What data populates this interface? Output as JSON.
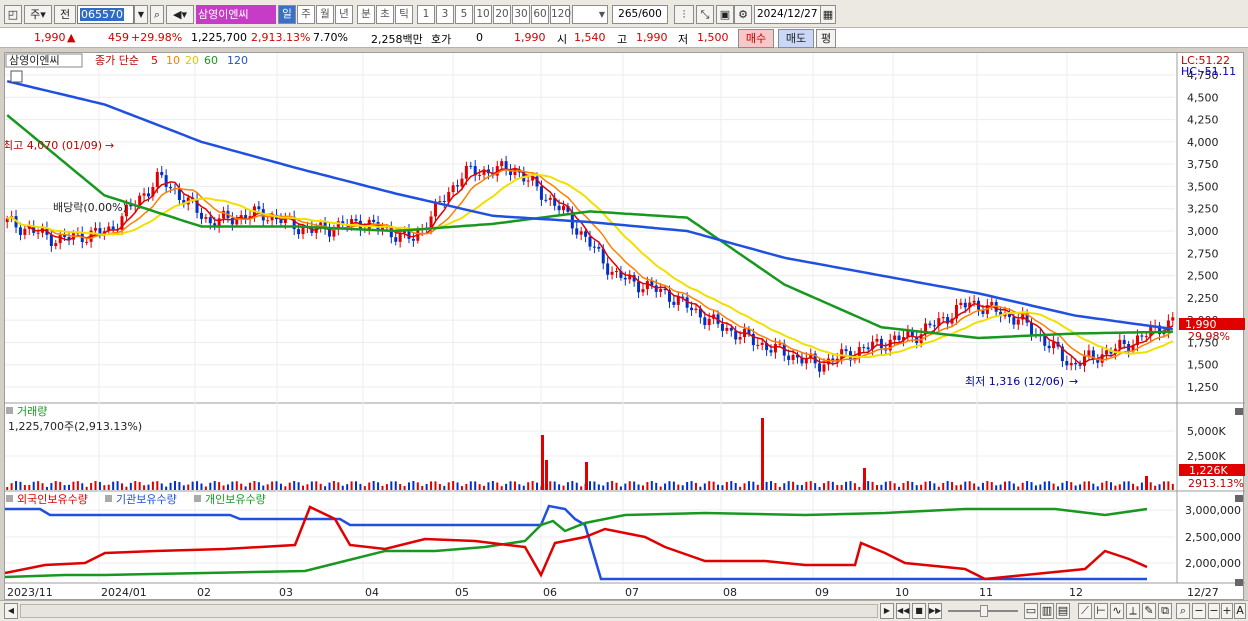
{
  "toolbar": {
    "mode1": "주",
    "mode2": "전",
    "code": "065570",
    "stock_name": "삼영이엔씨",
    "periods": [
      "일",
      "주",
      "월",
      "년",
      "분",
      "초",
      "틱"
    ],
    "active_period": "일",
    "intervals": [
      "1",
      "3",
      "5",
      "10",
      "20",
      "30",
      "60",
      "120"
    ],
    "count": "265",
    "count_max": "/600",
    "date": "2024/12/27"
  },
  "quote": {
    "price": "1,990",
    "change": "459",
    "change_pct": "+29.98%",
    "volume": "1,225,700",
    "volume_pct": "2,913.13%",
    "turnover_pct": "7.70%",
    "amount": "2,258백만",
    "hoga_label": "호가",
    "hoga_value": "0",
    "hoga_price": "1,990",
    "open_label": "시",
    "open": "1,540",
    "high_label": "고",
    "high": "1,990",
    "low_label": "저",
    "low": "1,500",
    "buy_label": "매수",
    "sell_label": "매도",
    "eval_label": "평"
  },
  "price_pane": {
    "stock_label": "삼영이엔씨",
    "ma_title": "종가 단순",
    "ma_periods": [
      "5",
      "10",
      "20",
      "60",
      "120"
    ],
    "ma_colors": [
      "#e00000",
      "#ff7f00",
      "#f0e000",
      "#189820",
      "#2050e0"
    ],
    "lc": "LC:51.22",
    "hc": "HC:-51.11",
    "high_note": "최고 4,070 (01/09)",
    "low_note": "최저 1,316 (12/06)",
    "dividend_note": "배당락(0.00%)",
    "last_price_tag": "1,990",
    "last_pct_tag": "29.98%"
  },
  "volume_pane": {
    "title": "거래량",
    "value": "1,225,700주(2,913.13%)",
    "tag": "1,226K",
    "tag_pct": "2913.13%"
  },
  "holders_pane": {
    "series": [
      "외국인보유수량",
      "기관보유수량",
      "개인보유수량"
    ],
    "colors": [
      "#e00000",
      "#2050e0",
      "#189820"
    ]
  },
  "chart_data": {
    "type": "line",
    "price_axis": [
      "4,750",
      "4,500",
      "4,250",
      "4,000",
      "3,750",
      "3,500",
      "3,250",
      "3,000",
      "2,750",
      "2,500",
      "2,250",
      "2,000",
      "1,750",
      "1,500",
      "1,250"
    ],
    "volume_axis": [
      "5,000K",
      "2,500K"
    ],
    "holders_axis": [
      "3,000,000",
      "2,500,000",
      "2,000,000"
    ],
    "x_labels": [
      "2023/11",
      "2024/01",
      "02",
      "03",
      "04",
      "05",
      "06",
      "07",
      "08",
      "09",
      "10",
      "11",
      "12",
      "12/27"
    ],
    "ma120_closes": [
      4680,
      4420,
      4000,
      3700,
      3420,
      3170,
      3100,
      3000,
      2700,
      2500,
      2300,
      2050,
      1900
    ],
    "ma60_closes": [
      4300,
      3400,
      3050,
      3050,
      3000,
      3080,
      3220,
      3150,
      2400,
      1920,
      1800,
      1850,
      1870
    ],
    "close_path": [
      3100,
      2900,
      3000,
      3600,
      3100,
      3200,
      3000,
      3100,
      2900,
      3650,
      3700,
      3200,
      2500,
      2300,
      1950,
      1700,
      1500,
      1700,
      1850,
      2200,
      2000,
      1500,
      1700,
      1990
    ]
  }
}
